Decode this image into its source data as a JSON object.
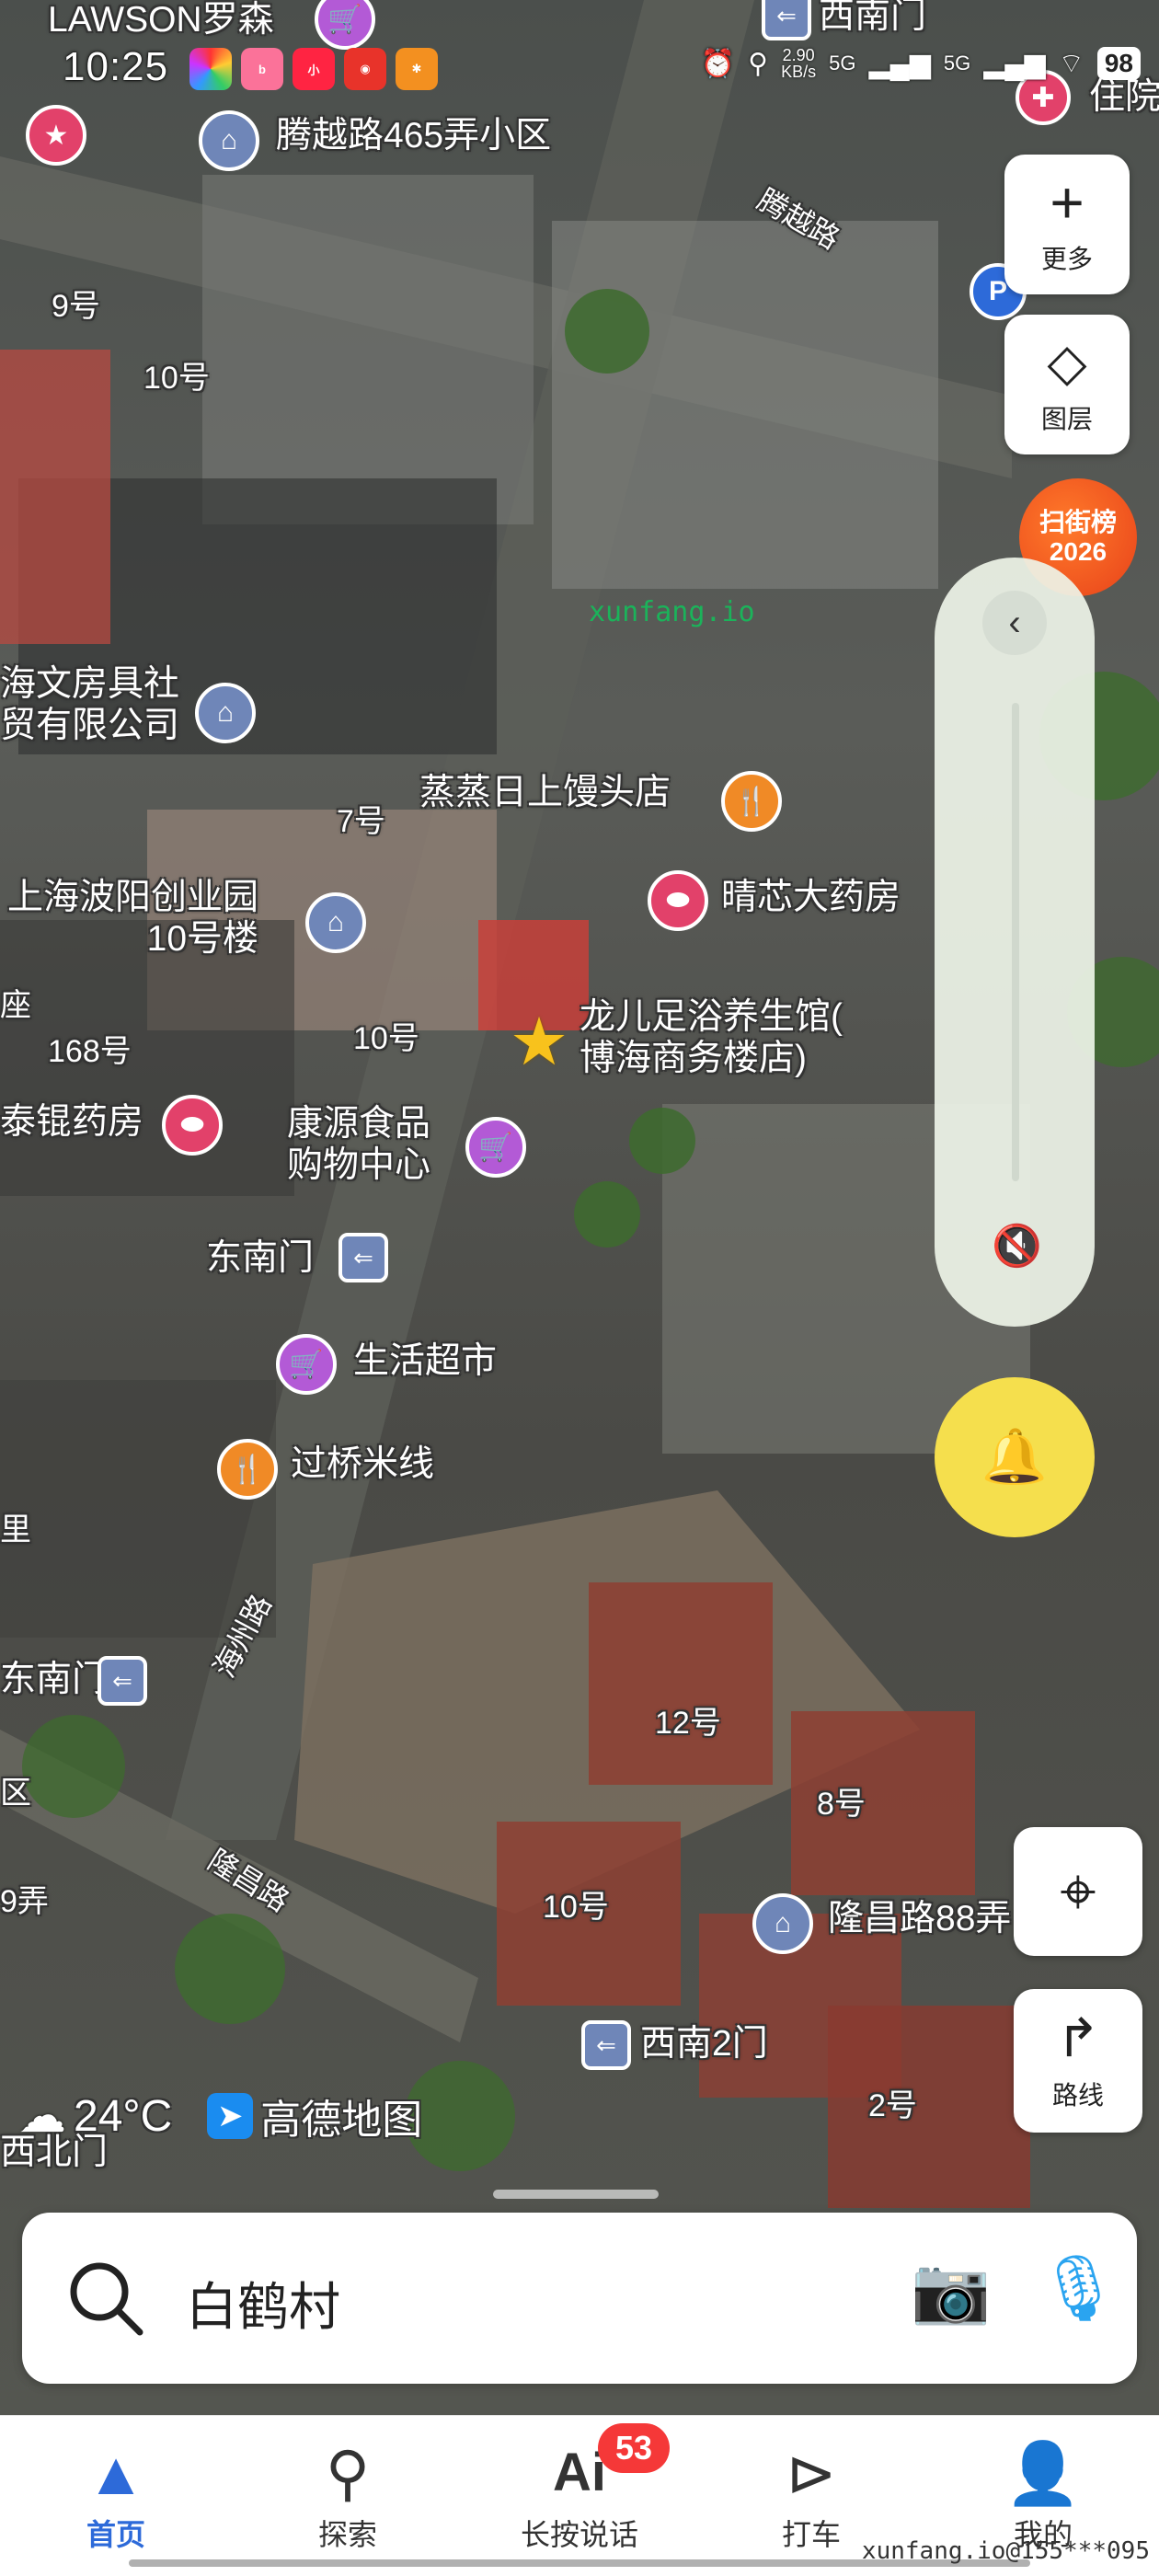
{
  "status_bar": {
    "time": "10:25",
    "net_speed": "2.90",
    "net_unit": "KB/s",
    "signal1": "5G",
    "signal2": "5G",
    "battery": "98"
  },
  "map": {
    "labels": {
      "lawson": "LAWSON罗森",
      "xinanmen_top": "西南门",
      "zhuyuan": "住院",
      "tengyue465": "腾越路465弄小区",
      "tengyue_road": "腾越路",
      "n9": "9号",
      "n10a": "10号",
      "wenju": "海文房具社\n贸有限公司",
      "mantou": "蒸蒸日上馒头店",
      "n7": "7号",
      "yaofang": "晴芯大药房",
      "boyang": "上海波阳创业园\n10号楼",
      "zuyu": "龙儿足浴养生馆(\n博海商务楼店)",
      "zuo": "座",
      "n168": "168号",
      "n10b": "10号",
      "taikun": "泰锟药房",
      "kangyuan": "康源食品\n购物中心",
      "dongnanmen": "东南门",
      "shenghuo": "生活超市",
      "guoqiao": "过桥米线",
      "li": "里",
      "haizhou_road": "海州路",
      "nanmen_left": "东南门",
      "qu": "区",
      "longchang_road": "隆昌路",
      "n9long": "9弄",
      "n12": "12号",
      "n8": "8号",
      "n10c": "10号",
      "longchang88": "隆昌路88弄",
      "xinan2": "西南2门",
      "n2": "2号",
      "xibeimen": "西北门"
    },
    "watermark": "xunfang.io"
  },
  "controls": {
    "more_label": "更多",
    "layers_label": "图层",
    "scan_line1": "扫街榜",
    "scan_line2": "2026",
    "route_label": "路线"
  },
  "weather": {
    "temperature": "24°C",
    "brand": "高德地图"
  },
  "search": {
    "query": "白鹤村"
  },
  "tabs": [
    {
      "label": "首页",
      "icon": "navigation-arrow-icon",
      "active": true
    },
    {
      "label": "探索",
      "icon": "map-pin-icon",
      "active": false
    },
    {
      "label": "长按说话",
      "icon": "ai-icon",
      "active": false,
      "badge": "53"
    },
    {
      "label": "打车",
      "icon": "taxi-icon",
      "active": false
    },
    {
      "label": "我的",
      "icon": "person-icon",
      "active": false
    }
  ],
  "footer_watermark": "xunfang.io@155***095",
  "colors": {
    "accent": "#2d6ad9",
    "badge": "#f53838",
    "bell": "#f5df4d",
    "scan": "#e8421a"
  }
}
